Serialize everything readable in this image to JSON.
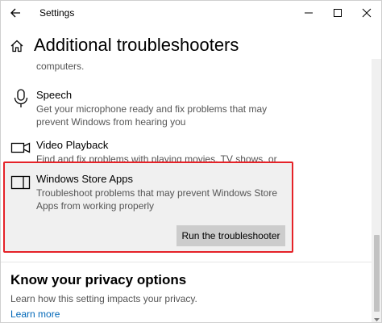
{
  "window": {
    "app_title": "Settings"
  },
  "header": {
    "page_title": "Additional troubleshooters"
  },
  "content": {
    "cut_text": "computers.",
    "items": [
      {
        "title": "Speech",
        "description": "Get your microphone ready and fix problems that may prevent Windows from hearing you",
        "icon": "microphone-icon"
      },
      {
        "title": "Video Playback",
        "description": "Find and fix problems with playing movies, TV shows, or videos",
        "icon": "video-camera-icon"
      },
      {
        "title": "Windows Store Apps",
        "description": "Troubleshoot problems that may prevent Windows Store Apps from working properly",
        "icon": "store-apps-icon",
        "button_label": "Run the troubleshooter"
      }
    ],
    "privacy": {
      "title": "Know your privacy options",
      "description": "Learn how this setting impacts your privacy.",
      "link": "Learn more"
    }
  },
  "colors": {
    "highlight_border": "#e52228",
    "link": "#0067b8",
    "button_bg": "#cccccc"
  }
}
